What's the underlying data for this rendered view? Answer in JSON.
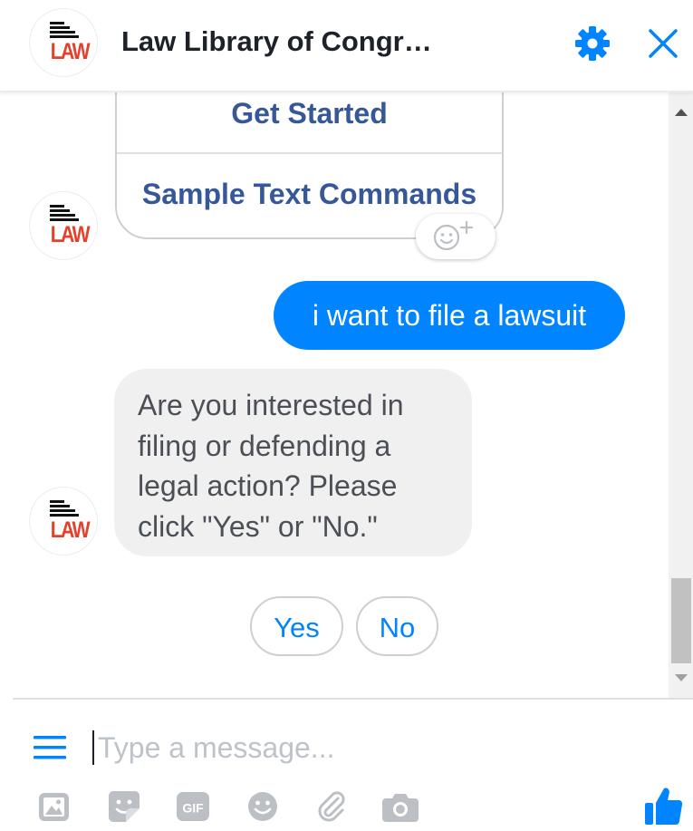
{
  "header": {
    "title": "Law Library of Congr…",
    "avatar_logo_text": "LAW",
    "settings_icon": "gear-icon",
    "close_icon": "close-icon"
  },
  "messages": {
    "card_buttons": [
      "Get Started",
      "Sample Text Commands"
    ],
    "reaction_icon": "smiley-plus-icon",
    "user_message": "i want to file a lawsuit",
    "bot_message_lines": [
      "Are you interested in",
      "filing or defending a",
      "legal action? Please",
      "click \"Yes\" or \"No.\""
    ]
  },
  "quick_replies": [
    "Yes",
    "No"
  ],
  "composer": {
    "placeholder": "Type a message...",
    "tools": [
      "image-icon",
      "sticker-icon",
      "gif-icon",
      "emoji-icon",
      "paperclip-icon",
      "camera-icon"
    ],
    "send_icon": "thumbs-up-icon"
  },
  "colors": {
    "accent": "#0084ff",
    "link": "#365899",
    "bubble_gray": "#f1f0f0",
    "logo_red": "#e4412b"
  }
}
